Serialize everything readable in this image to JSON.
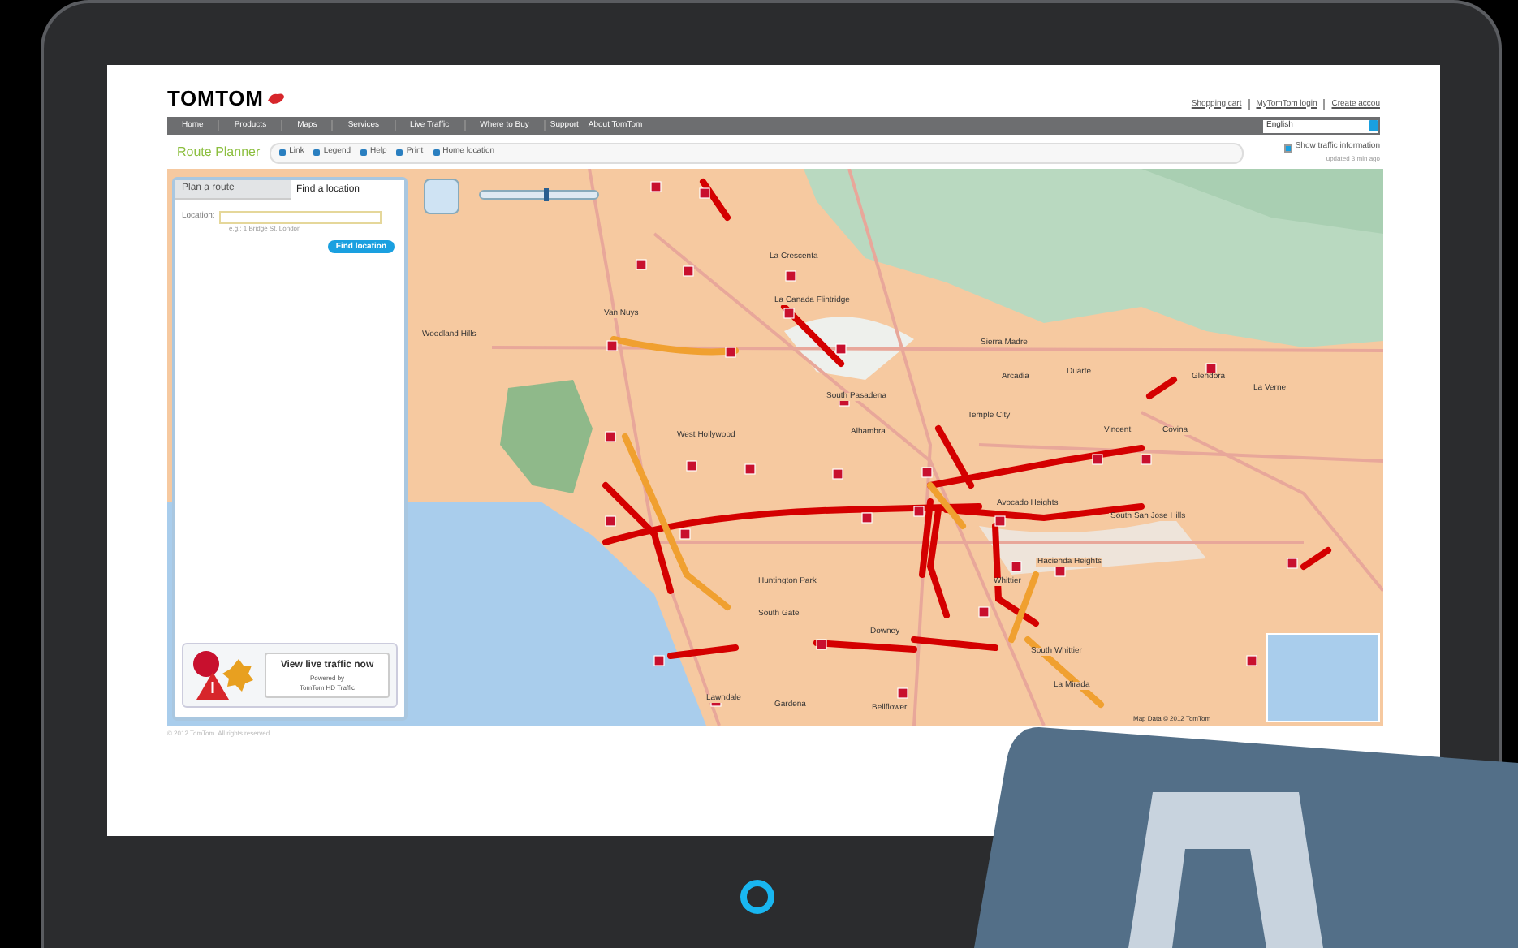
{
  "logo": "TOMTOM",
  "header_links": [
    "Shopping cart",
    "MyTomTom login",
    "Create accou"
  ],
  "nav": [
    "Home",
    "Products",
    "Maps",
    "Services",
    "Live Traffic",
    "Where to Buy",
    "Support",
    "About TomTom"
  ],
  "language": "English",
  "toolbar": {
    "title": "Route Planner",
    "items": [
      "Link",
      "Legend",
      "Help",
      "Print",
      "Home location"
    ]
  },
  "traffic_toggle": {
    "label": "Show traffic information",
    "checked": true,
    "updated": "updated 3 min ago"
  },
  "panel": {
    "tabs": [
      {
        "label": "Plan a route",
        "selected": false
      },
      {
        "label": "Find a location",
        "selected": true
      }
    ],
    "location_label": "Location:",
    "hint": "e.g.: 1 Bridge St, London",
    "button": "Find location",
    "promo": {
      "title": "View live traffic now",
      "line_1": "Powered by",
      "line_2": "TomTom HD Traffic"
    }
  },
  "map": {
    "zoom_slider": {
      "level": 0.55
    },
    "labels": [
      "Van Nuys",
      "Woodland Hills",
      "La Crescenta",
      "La Canada Flintridge",
      "Sierra Madre",
      "Arcadia",
      "Duarte",
      "Glendora",
      "La Verne",
      "South Pasadena",
      "Alhambra",
      "Temple City",
      "Vincent",
      "Covina",
      "West Hollywood",
      "Avocado Heights",
      "South San Jose Hills",
      "Hacienda Heights",
      "Huntington Park",
      "South Gate",
      "Whittier",
      "Downey",
      "South Whittier",
      "La Mirada",
      "Gardena",
      "Lawndale",
      "Bellflower"
    ],
    "map_data": "Map Data © 2012 TomTom"
  },
  "copyright": "© 2012 TomTom. All rights reserved."
}
